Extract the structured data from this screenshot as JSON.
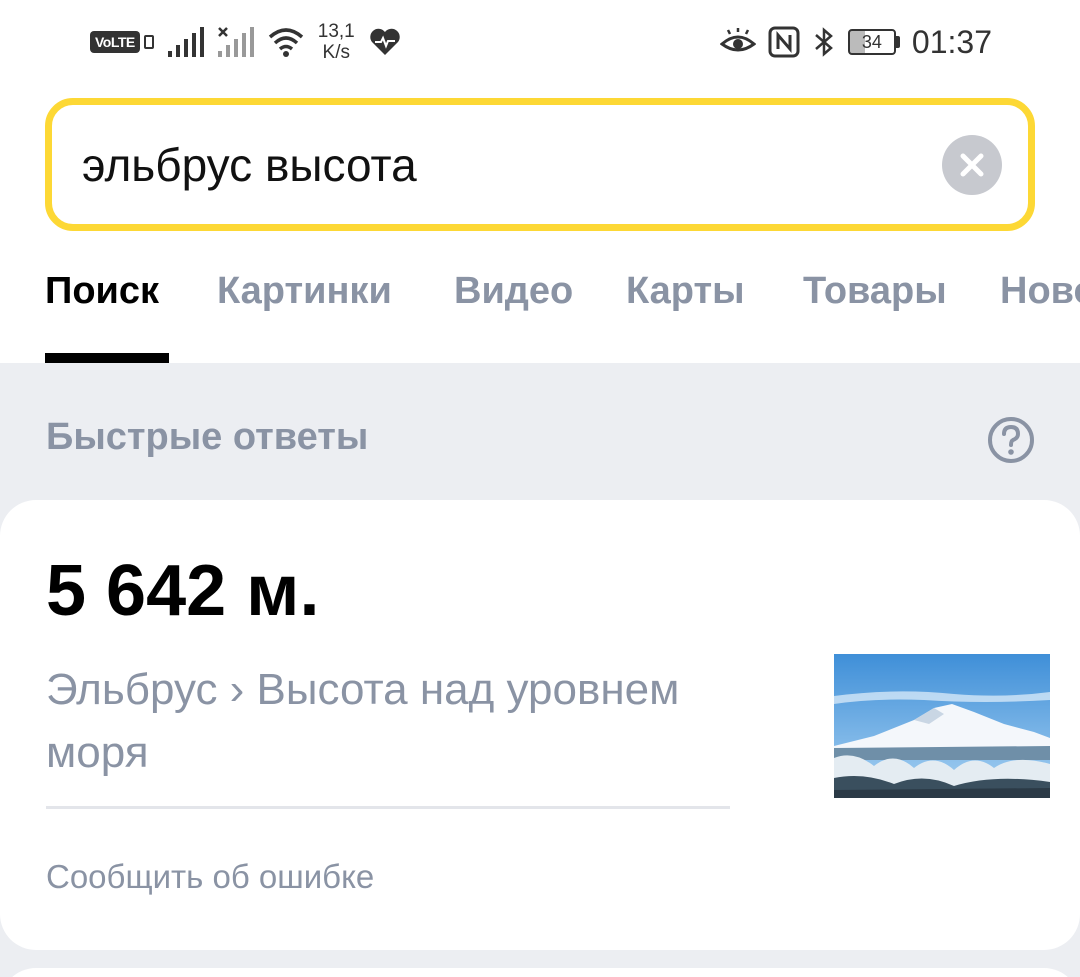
{
  "status_bar": {
    "volte": "VoLTE",
    "speed_value": "13,1",
    "speed_unit": "K/s",
    "battery": "34",
    "time": "01:37"
  },
  "search": {
    "query": "эльбрус высота"
  },
  "tabs": [
    {
      "label": "Поиск",
      "active": true
    },
    {
      "label": "Картинки",
      "active": false
    },
    {
      "label": "Видео",
      "active": false
    },
    {
      "label": "Карты",
      "active": false
    },
    {
      "label": "Товары",
      "active": false
    },
    {
      "label": "Новости",
      "active": false
    }
  ],
  "quick_answers": {
    "title": "Быстрые ответы"
  },
  "answer": {
    "value": "5 642 м.",
    "source": "Эльбрус › Высота над уровнем моря",
    "report_link": "Сообщить об ошибке"
  },
  "colors": {
    "search_border": "#fdd835",
    "tab_inactive": "#8a93a4",
    "background": "#eceef2"
  }
}
